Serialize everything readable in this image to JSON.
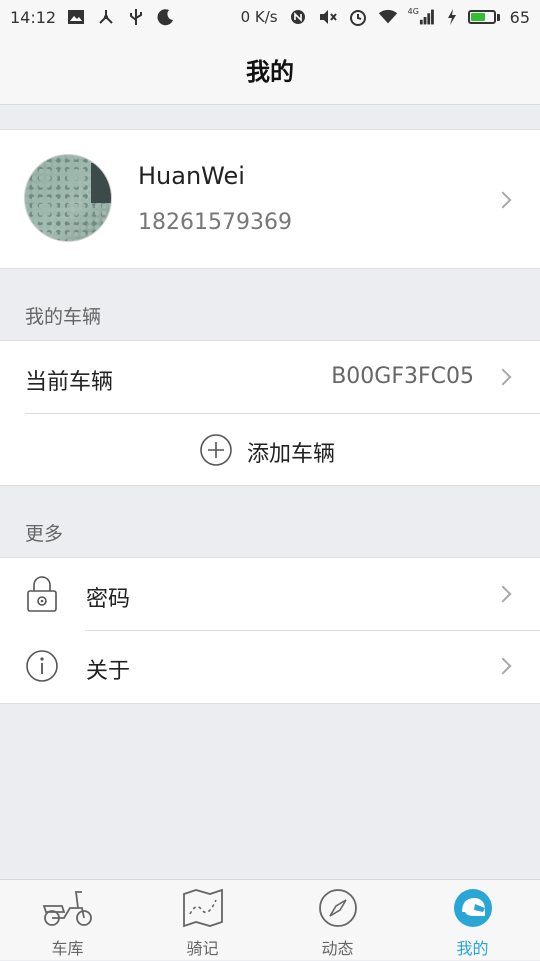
{
  "status_bar": {
    "time": "14:12",
    "net_speed": "0 K/s",
    "signal_type": "4G",
    "battery": "65",
    "battery_level": 0.65,
    "icons": [
      "image-icon",
      "share-icon",
      "usb-icon",
      "moon-icon",
      "nfc-icon",
      "mute-icon",
      "alarm-icon",
      "wifi-icon",
      "signal-icon",
      "charging-icon"
    ]
  },
  "header": {
    "title": "我的"
  },
  "profile": {
    "name": "HuanWei",
    "phone": "18261579369"
  },
  "vehicles_section": {
    "label": "我的车辆",
    "current_label": "当前车辆",
    "current_value": "B00GF3FC05",
    "add_label": "添加车辆"
  },
  "more_section": {
    "label": "更多",
    "items": [
      {
        "label": "密码",
        "icon": "lock-icon"
      },
      {
        "label": "关于",
        "icon": "info-icon"
      }
    ]
  },
  "tabs": [
    {
      "label": "车库",
      "icon": "scooter-icon",
      "active": false
    },
    {
      "label": "骑记",
      "icon": "map-icon",
      "active": false
    },
    {
      "label": "动态",
      "icon": "compass-icon",
      "active": false
    },
    {
      "label": "我的",
      "icon": "helmet-icon",
      "active": true
    }
  ],
  "colors": {
    "accent": "#2aa6d6",
    "background": "#ebedf0",
    "battery": "#2ec02e"
  }
}
